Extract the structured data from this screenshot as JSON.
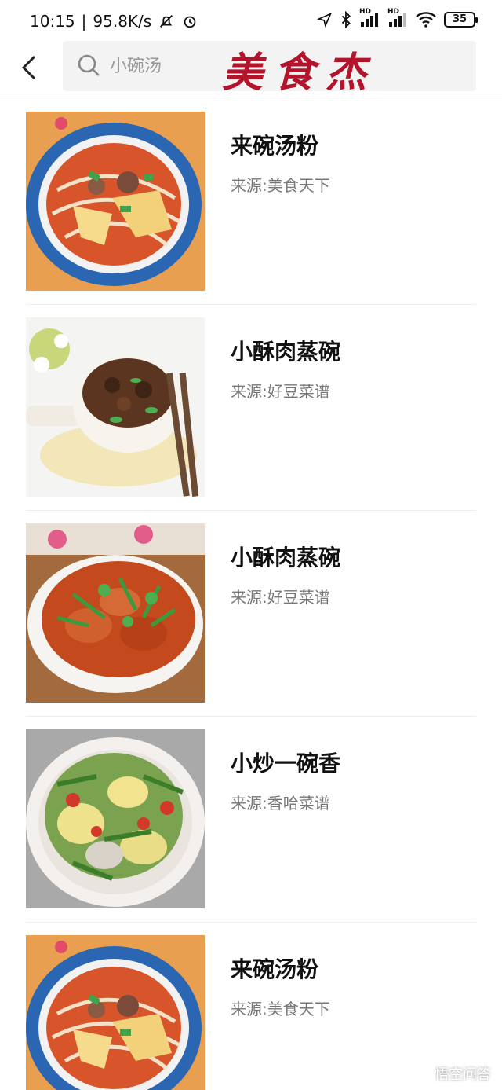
{
  "status_bar": {
    "time": "10:15",
    "speed": "95.8K/s",
    "battery": "35",
    "hd_1": "HD",
    "hd_2": "HD",
    "icons": [
      "mute-icon",
      "alarm-icon",
      "location-icon",
      "bluetooth-icon",
      "signal-icon",
      "wifi-icon",
      "battery-icon"
    ]
  },
  "header": {
    "search_placeholder": "小碗汤",
    "logo_text": "美食杰"
  },
  "results": [
    {
      "title": "来碗汤粉",
      "source": "来源:美食天下",
      "image": "noodle-soup"
    },
    {
      "title": "小酥肉蒸碗",
      "source": "来源:好豆菜谱",
      "image": "steamed-pork-bowl"
    },
    {
      "title": "小酥肉蒸碗",
      "source": "来源:好豆菜谱",
      "image": "fried-pork-cilantro"
    },
    {
      "title": "小炒一碗香",
      "source": "来源:香哈菜谱",
      "image": "stir-fry-egg-beans"
    },
    {
      "title": "来碗汤粉",
      "source": "来源:美食天下",
      "image": "noodle-soup"
    }
  ],
  "watermark": "悟空问答",
  "colors": {
    "logo": "#b3142b",
    "search_bg": "#f3f3f3",
    "source_text": "#777777"
  }
}
